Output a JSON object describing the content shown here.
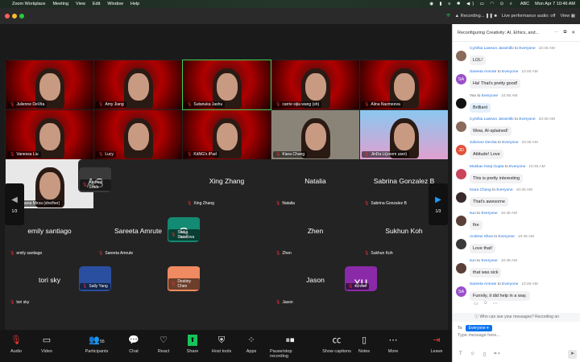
{
  "menubar": {
    "items": [
      "Zoom Workplace",
      "Meeting",
      "View",
      "Edit",
      "Window",
      "Help"
    ],
    "clock": "Mon Apr 7  10:46 AM",
    "abc": "ABC"
  },
  "titlebar": {
    "recording": "Recording...",
    "audio": "Live performance audio: off",
    "view": "View"
  },
  "pager": {
    "left": "1/3",
    "right": "1/3"
  },
  "tiles": [
    {
      "name": "Julienne DeVita",
      "type": "video"
    },
    {
      "name": "Amy Jiang",
      "type": "video"
    },
    {
      "name": "Sutanuka Jashu",
      "type": "video",
      "active": true
    },
    {
      "name": "carrie sijia wang (sh)",
      "type": "video"
    },
    {
      "name": "Alina Nazmeeva",
      "type": "video"
    },
    {
      "name": "Vanessa Liu",
      "type": "video"
    },
    {
      "name": "Lucy",
      "type": "video"
    },
    {
      "name": "KāNG's iPad",
      "type": "video"
    },
    {
      "name": "Kiara Chang",
      "type": "video"
    },
    {
      "name": "JinDa Li(zoom user)",
      "type": "video"
    },
    {
      "name": "Romana Mirza (she/her)",
      "type": "video"
    },
    {
      "name": "Andrew Shea",
      "type": "avatar",
      "avatar": "AS",
      "color": "#3a3a3a"
    },
    {
      "name": "Xing Zhang",
      "type": "blank",
      "display": "Xing Zhang"
    },
    {
      "name": "Natalia",
      "type": "blank",
      "display": "Natalia"
    },
    {
      "name": "Sabrina Gonzalez B",
      "type": "blank",
      "display": "Sabrina Gonzalez B"
    },
    {
      "name": "emily santiago",
      "type": "blank",
      "display": "emily santiago"
    },
    {
      "name": "Sareeta Amrute",
      "type": "blank",
      "display": "Sareeta Amrute"
    },
    {
      "name": "Sarka Samcova",
      "type": "avatar",
      "avatar": "S",
      "color": "#138a72"
    },
    {
      "name": "Zhen",
      "type": "blank",
      "display": "Zhen"
    },
    {
      "name": "Sukhun Koh",
      "type": "blank",
      "display": "Sukhun Koh"
    },
    {
      "name": "tori sky",
      "type": "blank",
      "display": "tori sky"
    },
    {
      "name": "Sally Yang",
      "type": "avatar",
      "avatar": "",
      "color": "#2a4fa0"
    },
    {
      "name": "Destiny Chen",
      "type": "avatar",
      "avatar": "",
      "color": "#f08a60"
    },
    {
      "name": "Jason",
      "type": "blank",
      "display": "Jason"
    },
    {
      "name": "xu eve",
      "type": "avatar",
      "avatar": "xu",
      "color": "#8a2aa8"
    }
  ],
  "toolbar": [
    {
      "label": "Audio",
      "icon": "mic-muted-icon",
      "glyph": "🎙"
    },
    {
      "label": "Video",
      "icon": "video-icon",
      "glyph": "▭"
    },
    {
      "label": "Participants",
      "icon": "participants-icon",
      "glyph": "👥",
      "count": "55"
    },
    {
      "label": "Chat",
      "icon": "chat-icon",
      "glyph": "💬"
    },
    {
      "label": "React",
      "icon": "heart-icon",
      "glyph": "♡"
    },
    {
      "label": "Share",
      "icon": "share-icon",
      "glyph": "⬆"
    },
    {
      "label": "Host tools",
      "icon": "shield-icon",
      "glyph": "⛨"
    },
    {
      "label": "Apps",
      "icon": "apps-icon",
      "glyph": "⁘"
    },
    {
      "label": "Pause/stop recording",
      "icon": "pause-stop-icon",
      "glyph": "⏸⏹"
    },
    {
      "label": "Show captions",
      "icon": "captions-icon",
      "glyph": "㏄"
    },
    {
      "label": "Notes",
      "icon": "notes-icon",
      "glyph": "▯"
    },
    {
      "label": "More",
      "icon": "more-icon",
      "glyph": "⋯"
    },
    {
      "label": "Leave",
      "icon": "leave-icon",
      "glyph": "⇥"
    }
  ],
  "chat": {
    "title": "Reconfiguring Creativity: AI, Ethics, and...",
    "to_word": "to",
    "messages": [
      {
        "sender": "Cynthia Lawson Jaramillo",
        "to": "Everyone",
        "time": "10:45 AM",
        "text": "LOL!",
        "avatar": "",
        "color": "#8a6a5a"
      },
      {
        "sender": "Sareeta Amrute",
        "to": "Everyone",
        "time": "10:45 AM",
        "text": "Ha! That's pretty good!",
        "avatar": "SA",
        "color": "#9b4fc9"
      },
      {
        "sender": "You",
        "to": "Everyone",
        "time": "10:45 AM",
        "text": "Brilliant",
        "avatar": "",
        "color": "#111",
        "me": true
      },
      {
        "sender": "Cynthia Lawson Jaramillo",
        "to": "Everyone",
        "time": "10:45 AM",
        "text": "Wow, AI-splained!",
        "avatar": "",
        "color": "#8a6a5a"
      },
      {
        "sender": "Julienne DeVita",
        "to": "Everyone",
        "time": "10:45 AM",
        "text": "Attitude! Love",
        "avatar": "JD",
        "color": "#e0523c"
      },
      {
        "sender": "Muskan Niraj Gupta",
        "to": "Everyone",
        "time": "10:45 AM",
        "text": "This is pretty interesting",
        "avatar": "",
        "color": "#c9455a"
      },
      {
        "sender": "Kiara Chang",
        "to": "Everyone",
        "time": "10:45 AM",
        "text": "That's awesome",
        "avatar": "",
        "color": "#3a2a2a"
      },
      {
        "sender": "sun",
        "to": "Everyone",
        "time": "10:45 AM",
        "text": "fire",
        "avatar": "",
        "color": "#5a4038"
      },
      {
        "sender": "Andrew Shea",
        "to": "Everyone",
        "time": "10:45 AM",
        "text": "Love that!",
        "avatar": "",
        "color": "#3a3a3a"
      },
      {
        "sender": "sun",
        "to": "Everyone",
        "time": "10:45 AM",
        "text": "that was sick",
        "avatar": "",
        "color": "#5a4038"
      },
      {
        "sender": "Sareeta Amrute",
        "to": "Everyone",
        "time": "10:45 AM",
        "text": "Funnily, it did help in a way.",
        "avatar": "SA",
        "color": "#9b4fc9"
      }
    ],
    "who_can_see": "Who can see your messages? Recording on",
    "to_label": "To:",
    "recipient": "Everyone",
    "placeholder": "Type message here..."
  }
}
